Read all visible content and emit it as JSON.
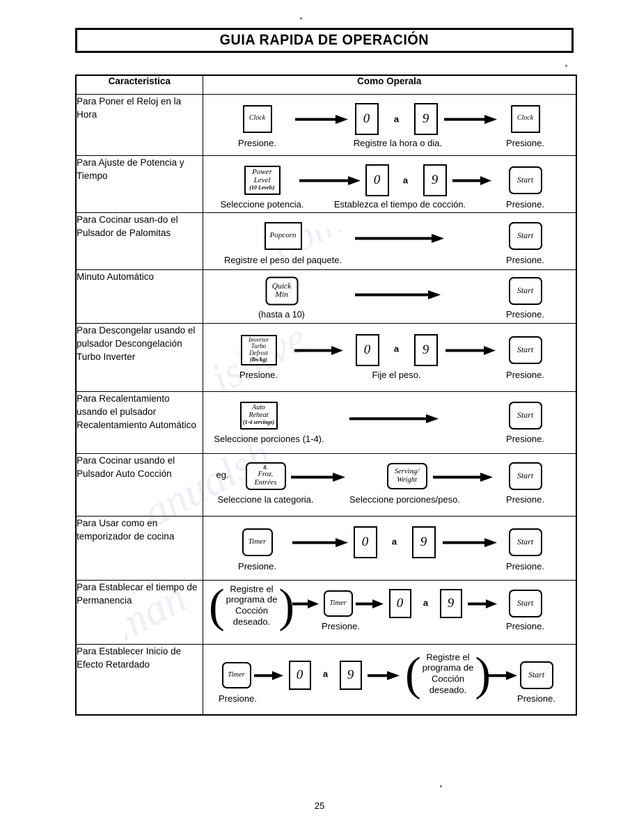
{
  "document": {
    "title": "GUIA RAPIDA DE OPERACIÓN",
    "page_number": "25"
  },
  "table": {
    "headers": {
      "feature": "Caracteristica",
      "how": "Como Operala"
    },
    "rows": [
      {
        "feature": "Para Poner el Reloj en la Hora",
        "steps": {
          "key1": "Clock",
          "caption1": "Presione.",
          "digit_from": "0",
          "range_word": "a",
          "digit_to": "9",
          "caption2": "Registre la hora o dia.",
          "key2": "Clock",
          "caption3": "Presione."
        }
      },
      {
        "feature": "Para Ajuste de Potencia y Tiempo",
        "steps": {
          "key1_line1": "Power",
          "key1_line2": "Level",
          "key1_line3": "(10 Levels)",
          "caption1": "Seleccione potencia.",
          "digit_from": "0",
          "range_word": "a",
          "digit_to": "9",
          "caption2": "Establezca el tiempo de cocción.",
          "key2": "Start",
          "caption3": "Presione."
        }
      },
      {
        "feature": "Para Cocinar usan-do el Pulsador de Palomitas",
        "steps": {
          "key1": "Popcorn",
          "caption1": "Registre el peso del paquete.",
          "key2": "Start",
          "caption3": "Presione."
        }
      },
      {
        "feature": "Minuto Automático",
        "steps": {
          "key1_line1": "Quick",
          "key1_line2": "Min",
          "caption1": "(hasta a 10)",
          "key2": "Start",
          "caption3": "Presione."
        }
      },
      {
        "feature": "Para Descongelar usando el pulsador Descongelación Turbo Inverter",
        "steps": {
          "key1_line1": "Inverter",
          "key1_line2": "Turbo",
          "key1_line3": "Defrost",
          "key1_line4": "(lbs/kg)",
          "caption1": "Presione.",
          "digit_from": "0",
          "range_word": "a",
          "digit_to": "9",
          "caption2": "Fije el peso.",
          "key2": "Start",
          "caption3": "Presione."
        }
      },
      {
        "feature": "Para Recalentamiento usando el pulsador Recalentamiento Automático",
        "steps": {
          "key1_line1": "Auto",
          "key1_line2": "Reheat",
          "key1_line3": "(1-4 servings)",
          "caption1": "Seleccione porciones (1-4).",
          "key2": "Start",
          "caption3": "Presione."
        }
      },
      {
        "feature": "Para Cocinar usando el Pulsador Auto Cocción",
        "steps": {
          "eg_label": "eg.",
          "key1_line1": "8.",
          "key1_line2": "Froz.",
          "key1_line3": "Entrées",
          "caption1": "Seleccione la categoria.",
          "key2_line1": "Serving/",
          "key2_line2": "Weight",
          "caption2": "Seleccione porciones/peso.",
          "key3": "Start",
          "caption3": "Presione."
        }
      },
      {
        "feature": "Para Usar como en temporizador de cocina",
        "steps": {
          "key1": "Timer",
          "caption1": "Presione.",
          "digit_from": "0",
          "range_word": "a",
          "digit_to": "9",
          "key2": "Start",
          "caption3": "Presione."
        }
      },
      {
        "feature": "Para Establecar el tiempo de Permanencia",
        "steps": {
          "bubble": "Registre el programa de Cocción deseado.",
          "key1": "Timer",
          "caption1": "Presione.",
          "digit_from": "0",
          "range_word": "a",
          "digit_to": "9",
          "key2": "Start",
          "caption3": "Presione."
        }
      },
      {
        "feature": "Para Establecer Inicio de Efecto Retardado",
        "steps": {
          "key1": "Timer",
          "caption1": "Presione.",
          "digit_from": "0",
          "range_word": "a",
          "digit_to": "9",
          "bubble": "Registre el programa de Cocción deseado.",
          "key2": "Start",
          "caption3": "Presione."
        }
      }
    ]
  }
}
